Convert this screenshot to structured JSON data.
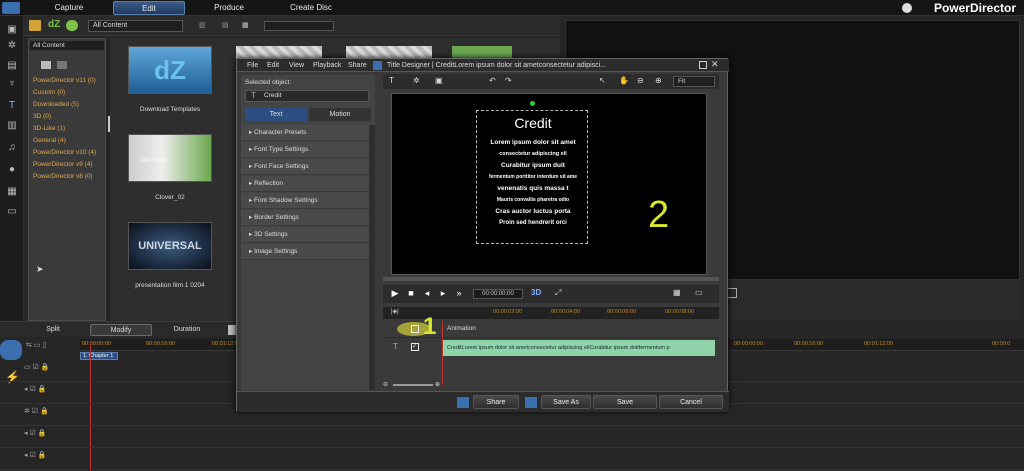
{
  "topbar": {
    "tabs": [
      "Capture",
      "Edit",
      "Produce",
      "Create Disc"
    ],
    "brand": "PowerDirector"
  },
  "library": {
    "filter": "All Content",
    "categories": [
      "All Content",
      "PowerDirector v11 (0)",
      "Custom (0)",
      "Downloaded (5)",
      "3D (0)",
      "3D-Like (1)",
      "General (4)",
      "PowerDirector v10 (4)",
      "PowerDirector v9 (4)",
      "PowerDirector v8 (0)"
    ],
    "items": [
      {
        "caption": "Download Templates",
        "thumb_text": "dZ"
      },
      {
        "caption": "Clover_02",
        "thumb_text": "Title Here"
      },
      {
        "caption": "presentation film 1 0204",
        "thumb_text": "UNIVERSAL"
      }
    ]
  },
  "edit_toolbar": {
    "split": "Split",
    "modify": "Modify",
    "duration": "Duration"
  },
  "timeline": {
    "ticks_left": [
      "00:00:00:00",
      "00:00:16:00",
      "00:01:12:0"
    ],
    "ticks_right": [
      "00:00:00:00",
      "00:00:16:00",
      "00:01:12:00",
      "00:00:0"
    ],
    "chapter": "1. Chapter 1"
  },
  "dialog": {
    "menus": [
      "File",
      "Edit",
      "View",
      "Playback",
      "Share"
    ],
    "title": "Title Designer | CreditLorem ipsum dolor sit ametconsectetur adipisci...",
    "selected_label": "Selected object:",
    "selected_value": "Credit",
    "tabs": [
      "Text",
      "Motion"
    ],
    "sections": [
      "Character Presets",
      "Font Type Settings",
      "Font Face Settings",
      "Reflection",
      "Font Shadow Settings",
      "Border Settings",
      "3D Settings",
      "Image Settings"
    ],
    "zoom": "Fit",
    "credit_title": "Credit",
    "credit_lines": [
      "Lorem ipsum dolor sit amet",
      "consectetur adipiscing eli",
      "Curabitur ipsum duit",
      "fermentum porttitor interdum sit ame",
      "venenatis quis massa t",
      "Mauris convallis pharetra odio",
      "Cras auctor luctus porta",
      "Proin sed hendrerit orci"
    ],
    "annotation_2": "2",
    "annotation_1": "1",
    "timecode": "00:00:00:00",
    "ruler": [
      "00:00:02:00",
      "00:00:04:00",
      "00:00:06:00",
      "00:00:08:00"
    ],
    "track_animation": "Animation",
    "track_text": "CreditLorem ipsum dolor sit ametconsectetur adipiscing eliCurabitur ipsum doitfermentum p",
    "buttons": {
      "share": "Share",
      "save_as": "Save As",
      "save": "Save",
      "cancel": "Cancel"
    }
  }
}
